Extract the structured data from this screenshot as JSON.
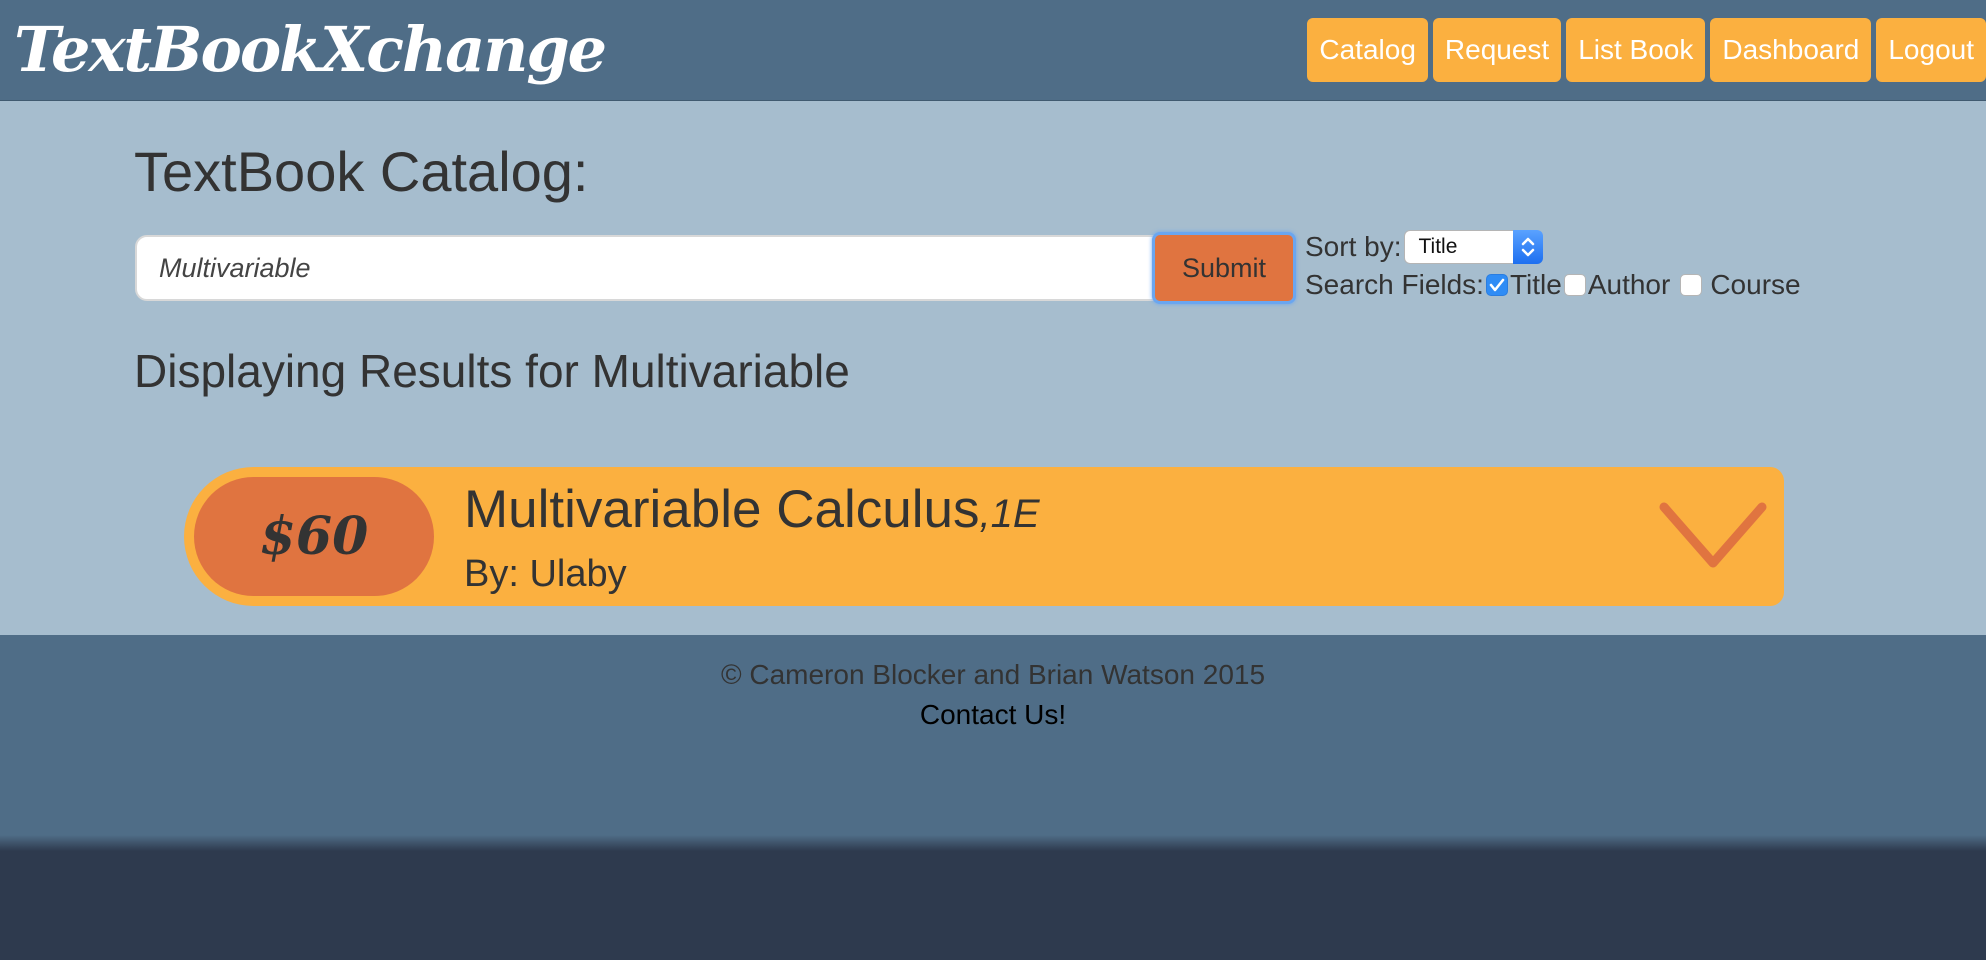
{
  "header": {
    "logo": "TextBookXchange",
    "nav": [
      {
        "label": "Catalog"
      },
      {
        "label": "Request"
      },
      {
        "label": "List Book"
      },
      {
        "label": "Dashboard"
      },
      {
        "label": "Logout"
      }
    ]
  },
  "main": {
    "page_title": "TextBook Catalog:",
    "search": {
      "value": "Multivariable",
      "submit_label": "Submit"
    },
    "sort": {
      "label": "Sort by:",
      "selected": "Title"
    },
    "search_fields": {
      "label": "Search Fields:",
      "options": [
        {
          "label": "Title",
          "checked": true
        },
        {
          "label": "Author",
          "checked": false
        },
        {
          "label": "Course",
          "checked": false
        }
      ]
    },
    "results_heading": "Displaying Results for Multivariable",
    "results": [
      {
        "price": "$60",
        "title": "Multivariable Calculus",
        "edition_sep": ",",
        "edition": "1E",
        "author": "By: Ulaby"
      }
    ]
  },
  "footer": {
    "copyright": "© Cameron Blocker and Brian Watson 2015",
    "contact": "Contact Us!"
  },
  "colors": {
    "header_bg": "#4f6d87",
    "main_bg": "#a6bdce",
    "accent_orange": "#fbb040",
    "accent_dark_orange": "#e07440",
    "text_dark": "#333333",
    "page_bottom": "#2e3a4e"
  }
}
